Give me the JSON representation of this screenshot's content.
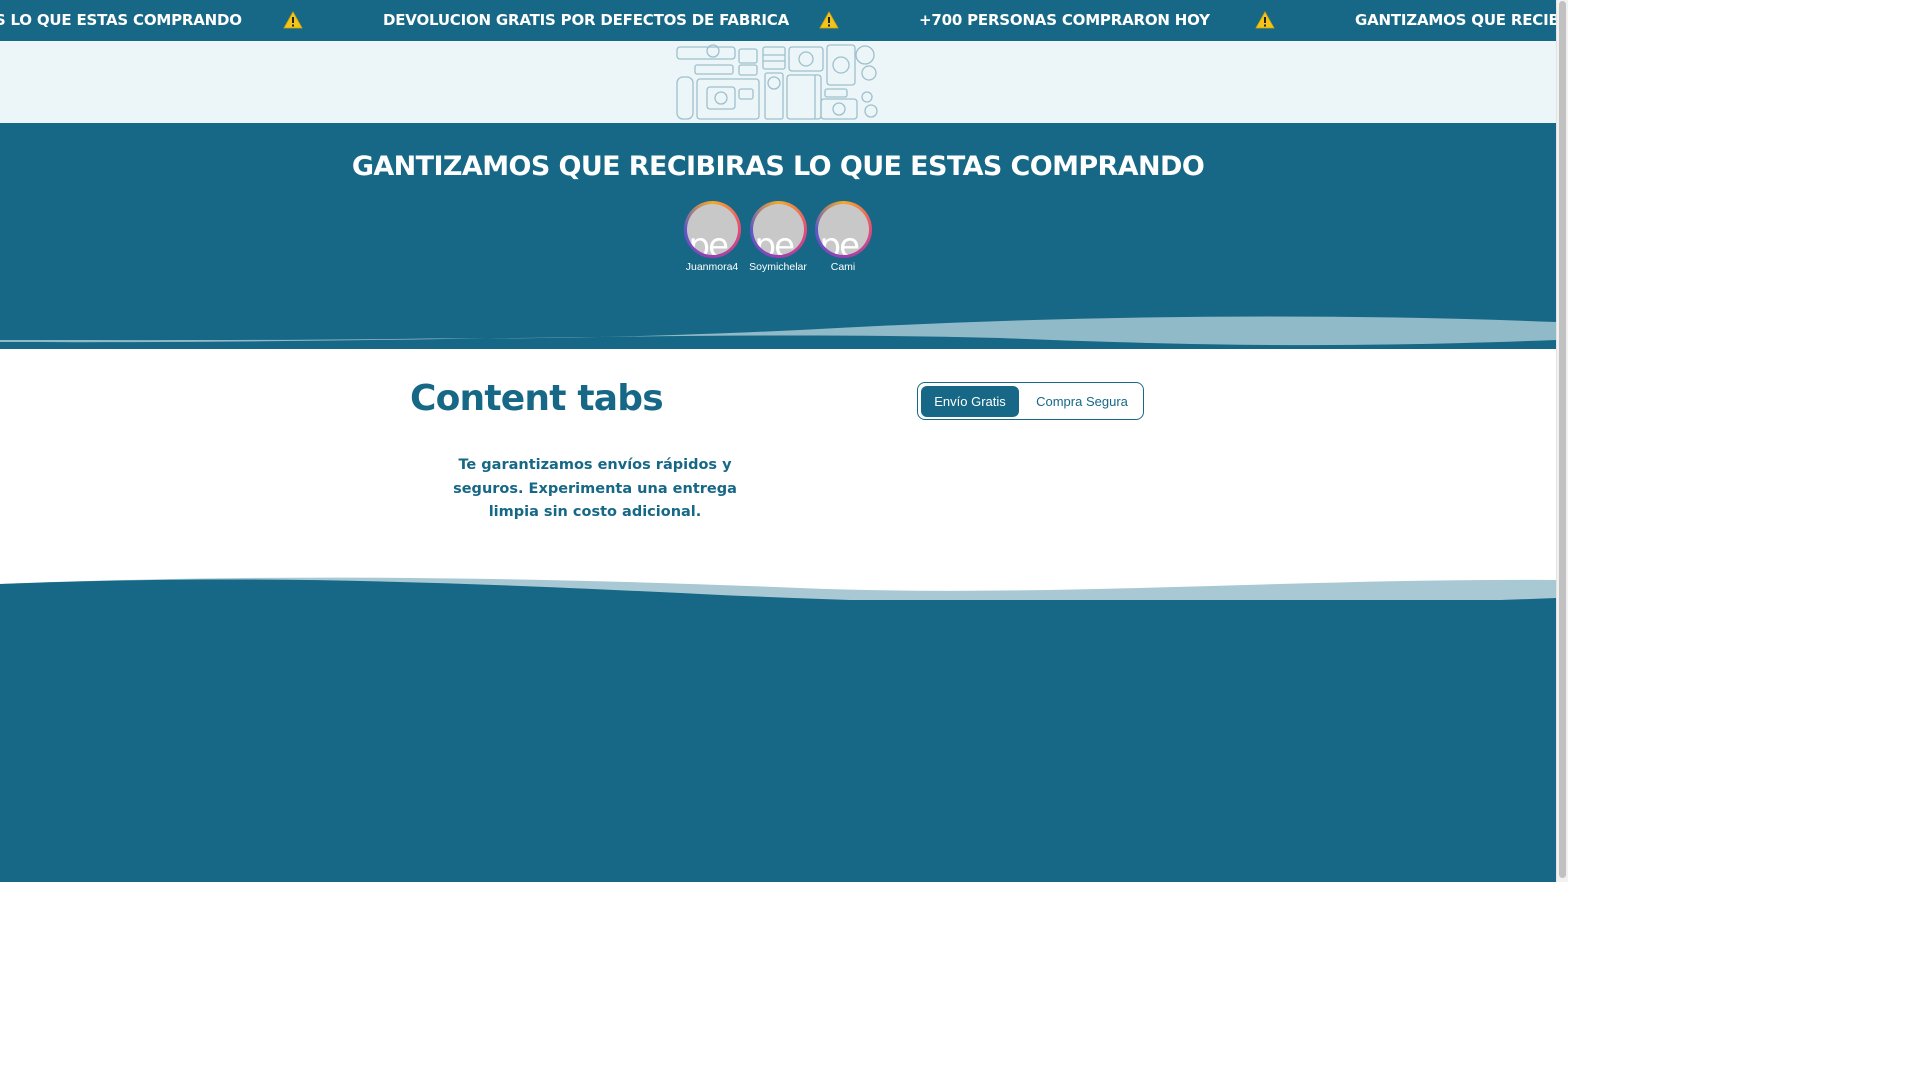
{
  "ticker": {
    "items": [
      "GANTIZAMOS QUE RECIBIRAS LO QUE ESTAS COMPRANDO",
      "DEVOLUCION GRATIS POR DEFECTOS DE FABRICA",
      "+700 PERSONAS COMPRARON HOY",
      "GANTIZAMOS QUE RECIBIRAS LO QUE ESTAS COMPRANDO"
    ],
    "separator_icon": "warning-icon"
  },
  "header": {
    "logo_icon": "travel-gear-illustration"
  },
  "hero": {
    "title": "GANTIZAMOS QUE RECIBIRAS LO QUE ESTAS COMPRANDO",
    "avatars": [
      {
        "name": "Juanmora4",
        "glyph": "pe"
      },
      {
        "name": "Soymichelar",
        "glyph": "pe"
      },
      {
        "name": "Cami",
        "glyph": "pe"
      }
    ]
  },
  "content": {
    "title": "Content tabs",
    "tabs": [
      {
        "label": "Envío Gratis",
        "active": true
      },
      {
        "label": "Compra Segura",
        "active": false
      }
    ],
    "active_tab_text": "Te garantizamos envíos rápidos y seguros. Experimenta una entrega limpia sin costo adicional."
  },
  "colors": {
    "primary": "#166886",
    "light_band": "#ecf5f8",
    "wave_light": "#9fc3cf",
    "warning": "#f2c51d"
  }
}
